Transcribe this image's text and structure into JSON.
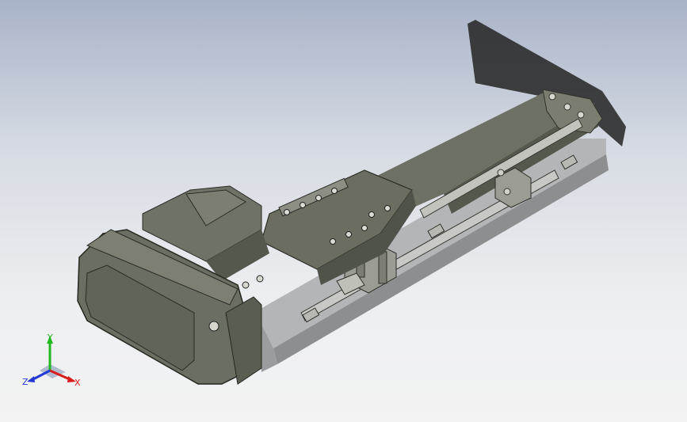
{
  "viewport": {
    "background_top": "#a9b3c8",
    "background_bottom": "#f3f3f3",
    "body_color": "#6b6e62",
    "rail_color": "#a7a9ab",
    "shadow_color": "#2a2a2a"
  },
  "triad": {
    "x_label": "X",
    "y_label": "Y",
    "z_label": "Z",
    "x_color": "#d81c1c",
    "y_color": "#1fb81f",
    "z_color": "#2239d8"
  }
}
